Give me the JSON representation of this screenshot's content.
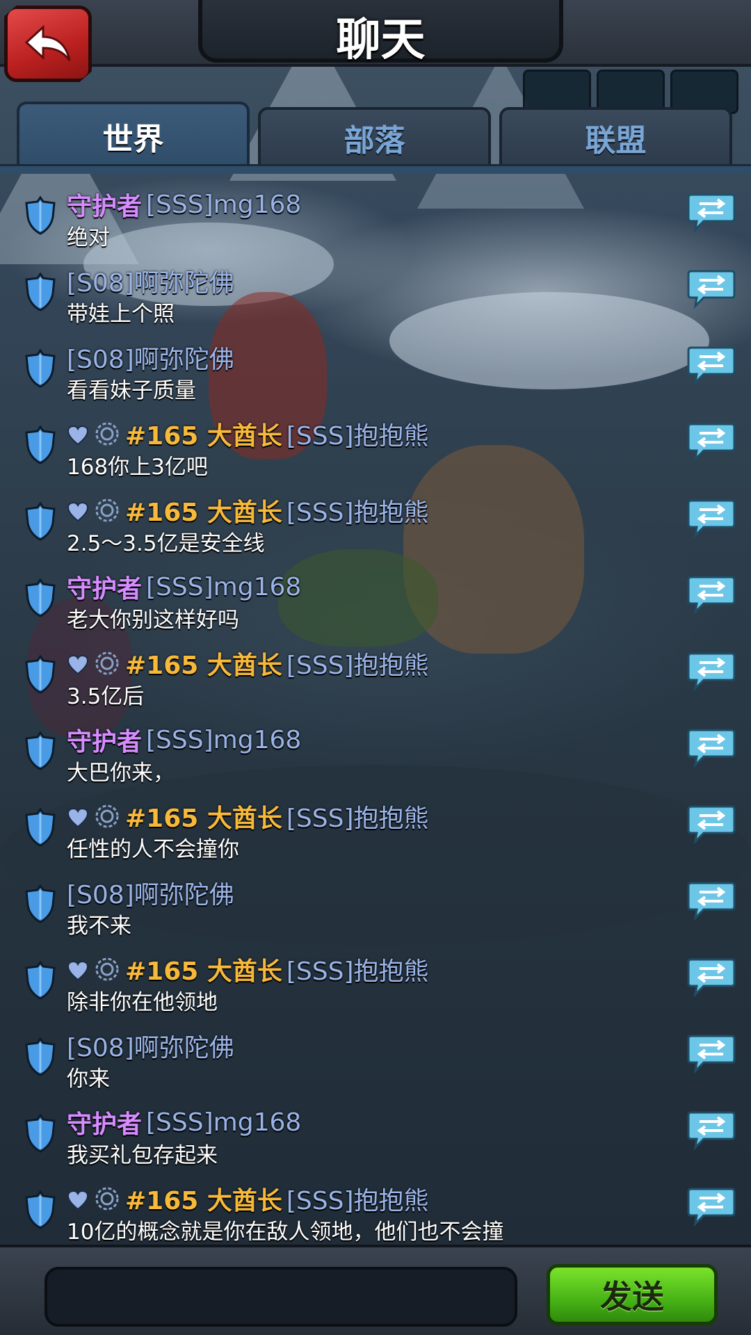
{
  "header": {
    "title": "聊天",
    "back_icon": "back-arrow-icon"
  },
  "tabs": [
    {
      "label": "世界",
      "active": true
    },
    {
      "label": "部落",
      "active": false
    },
    {
      "label": "联盟",
      "active": false
    }
  ],
  "colors": {
    "guardian_title": "#d68cff",
    "chief_title": "#f7b93a",
    "username": "#9ab4e8",
    "message": "#ffffff",
    "send_button": "#47b316"
  },
  "messages": [
    {
      "type": "guard",
      "title": "守护者",
      "name": "[SSS]mg168",
      "text": "绝对"
    },
    {
      "type": "plain",
      "name": "[S08]啊弥陀佛",
      "text": "带娃上个照"
    },
    {
      "type": "plain",
      "name": "[S08]啊弥陀佛",
      "text": "看看妹子质量"
    },
    {
      "type": "chief",
      "title": "#165 大酋长",
      "name": "[SSS]抱抱熊",
      "text": "168你上3亿吧"
    },
    {
      "type": "chief",
      "title": "#165 大酋长",
      "name": "[SSS]抱抱熊",
      "text": "2.5～3.5亿是安全线"
    },
    {
      "type": "guard",
      "title": "守护者",
      "name": "[SSS]mg168",
      "text": "老大你别这样好吗"
    },
    {
      "type": "chief",
      "title": "#165 大酋长",
      "name": "[SSS]抱抱熊",
      "text": "3.5亿后"
    },
    {
      "type": "guard",
      "title": "守护者",
      "name": "[SSS]mg168",
      "text": "大巴你来，"
    },
    {
      "type": "chief",
      "title": "#165 大酋长",
      "name": "[SSS]抱抱熊",
      "text": "任性的人不会撞你"
    },
    {
      "type": "plain",
      "name": "[S08]啊弥陀佛",
      "text": "我不来"
    },
    {
      "type": "chief",
      "title": "#165 大酋长",
      "name": "[SSS]抱抱熊",
      "text": "除非你在他领地"
    },
    {
      "type": "plain",
      "name": "[S08]啊弥陀佛",
      "text": "你来"
    },
    {
      "type": "guard",
      "title": "守护者",
      "name": "[SSS]mg168",
      "text": "我买礼包存起来"
    },
    {
      "type": "chief",
      "title": "#165 大酋长",
      "name": "[SSS]抱抱熊",
      "text": "10亿的概念就是你在敌人领地，他们也不会撞"
    }
  ],
  "footer": {
    "input_value": "",
    "send_label": "发送"
  }
}
